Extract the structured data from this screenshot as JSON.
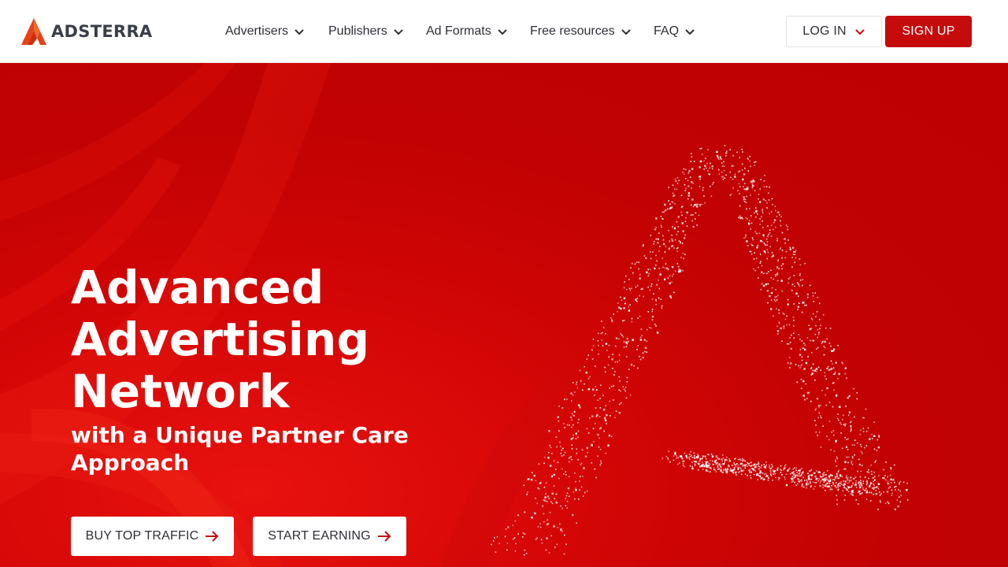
{
  "brand": {
    "name": "ADSTERRA",
    "accent_color": "#c50b0b",
    "logo_icon": "adsterra-logo-icon"
  },
  "nav": {
    "items": [
      {
        "label": "Advertisers",
        "icon": "chevron-down-icon"
      },
      {
        "label": "Publishers",
        "icon": "chevron-down-icon"
      },
      {
        "label": "Ad Formats",
        "icon": "chevron-down-icon"
      },
      {
        "label": "Free resources",
        "icon": "chevron-down-icon"
      },
      {
        "label": "FAQ",
        "icon": "chevron-down-icon"
      }
    ]
  },
  "auth": {
    "login_label": "LOG IN",
    "signup_label": "SIGN UP"
  },
  "hero": {
    "headline_line1": "Advanced",
    "headline_line2": "Advertising",
    "headline_line3": "Network",
    "subline_line1": "with a Unique Partner Care",
    "subline_line2": "Approach",
    "background_color": "#c40202",
    "particle_shape": "adsterra-a-particles",
    "cta_primary": {
      "label": "BUY TOP TRAFFIC",
      "icon": "arrow-right-icon"
    },
    "cta_secondary": {
      "label": "START EARNING",
      "icon": "arrow-right-icon"
    }
  }
}
